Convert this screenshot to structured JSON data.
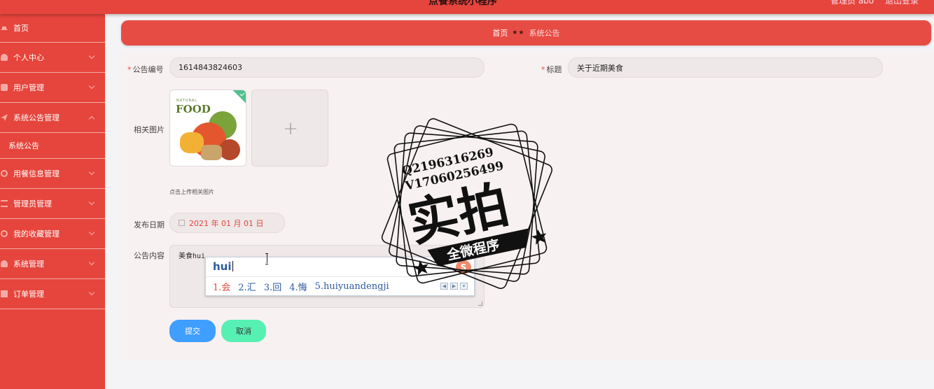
{
  "header": {
    "app_title": "点餐系统小程序",
    "user": "管理员 abo",
    "logout": "退出登录"
  },
  "sidebar": {
    "items": [
      {
        "label": "首页",
        "icon": "home-icon"
      },
      {
        "label": "个人中心",
        "icon": "user-icon"
      },
      {
        "label": "用户管理",
        "icon": "chat-icon"
      },
      {
        "label": "系统公告管理",
        "icon": "send-icon"
      },
      {
        "label": "系统公告",
        "icon": ""
      },
      {
        "label": "用餐信息管理",
        "icon": "power-icon"
      },
      {
        "label": "管理员管理",
        "icon": "sliders-icon"
      },
      {
        "label": "我的收藏管理",
        "icon": "clock-icon"
      },
      {
        "label": "系统管理",
        "icon": "user-icon"
      },
      {
        "label": "订单管理",
        "icon": "grid-icon"
      }
    ]
  },
  "breadcrumb": {
    "home": "首页",
    "separator": "★★",
    "current": "系统公告"
  },
  "form": {
    "notice_no_label": "公告编号",
    "notice_no_value": "1614843824603",
    "title_label": "标题",
    "title_value": "关于近期美食",
    "image_label": "相关图片",
    "image_natural": "NATURAL",
    "image_food": "FOOD",
    "upload_hint": "点击上传相关图片",
    "upload_plus": "+",
    "date_label": "发布日期",
    "date_value": "2021 年 01 月 01 日",
    "content_label": "公告内容",
    "content_value": "美食hui",
    "required_mark": "*"
  },
  "ime": {
    "composition": "hui",
    "candidates": [
      "1.会",
      "2.汇",
      "3.回",
      "4.悔",
      "5.huiyuandengji"
    ],
    "logo": "S",
    "prev": "◀",
    "next": "▶",
    "more": "▾"
  },
  "buttons": {
    "submit": "提交",
    "cancel": "取消"
  },
  "watermark": {
    "line1": "Q2196316269",
    "line2": "V17060256499",
    "main": "实拍",
    "ribbon": "全微程序"
  },
  "colors": {
    "primary": "#e5453c",
    "submit": "#409eff",
    "cancel": "#57f0b3"
  }
}
